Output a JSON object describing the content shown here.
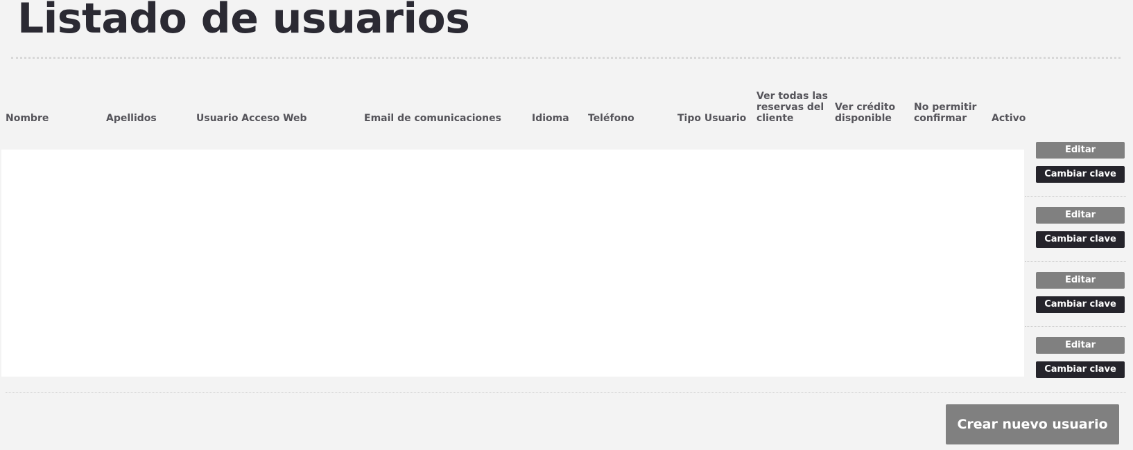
{
  "page": {
    "title": "Listado de usuarios"
  },
  "table": {
    "columns": [
      {
        "label": "Nombre"
      },
      {
        "label": "Apellidos"
      },
      {
        "label": "Usuario Acceso Web"
      },
      {
        "label": "Email de comunicaciones"
      },
      {
        "label": "Idioma"
      },
      {
        "label": "Teléfono"
      },
      {
        "label": "Tipo Usuario"
      },
      {
        "label": "Ver todas las\nreservas del\ncliente"
      },
      {
        "label": "Ver crédito\ndisponible"
      },
      {
        "label": "No permitir\nconfirmar"
      },
      {
        "label": "Activo"
      }
    ],
    "rows": [
      {
        "edit_label": "Editar",
        "change_password_label": "Cambiar clave"
      },
      {
        "edit_label": "Editar",
        "change_password_label": "Cambiar clave"
      },
      {
        "edit_label": "Editar",
        "change_password_label": "Cambiar clave"
      },
      {
        "edit_label": "Editar",
        "change_password_label": "Cambiar clave"
      }
    ]
  },
  "actions": {
    "create_label": "Crear nuevo usuario"
  },
  "colors": {
    "background": "#f3f3f3",
    "table_body": "#ffffff",
    "edit_button": "#808080",
    "change_password_button": "#25242b",
    "create_button": "#808080",
    "title_text": "#2b2a33"
  }
}
